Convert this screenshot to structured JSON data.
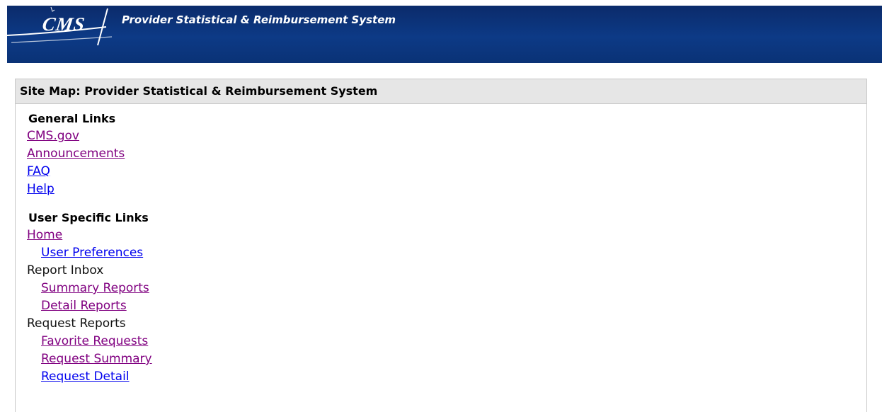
{
  "header": {
    "logo_text": "CMS",
    "title": "Provider Statistical & Reimbursement System"
  },
  "sitemap": {
    "title": "Site Map: Provider Statistical & Reimbursement System",
    "general_heading": "General Links",
    "general_links": [
      {
        "label": "CMS.gov",
        "visited": true
      },
      {
        "label": "Announcements",
        "visited": true
      },
      {
        "label": "FAQ",
        "visited": false
      },
      {
        "label": "Help",
        "visited": false
      }
    ],
    "user_heading": "User Specific Links",
    "home": "Home",
    "user_preferences": "User Preferences",
    "report_inbox": "Report Inbox",
    "summary_reports": "Summary Reports",
    "detail_reports": "Detail Reports",
    "request_reports": "Request Reports",
    "favorite_requests": "Favorite Requests",
    "request_summary": "Request Summary",
    "request_detail": "Request Detail"
  },
  "colors": {
    "header_blue": "#0d3a86",
    "link_visited": "#800080",
    "link_unvisited": "#0000ee",
    "panel_title_bg": "#e6e6e6"
  }
}
